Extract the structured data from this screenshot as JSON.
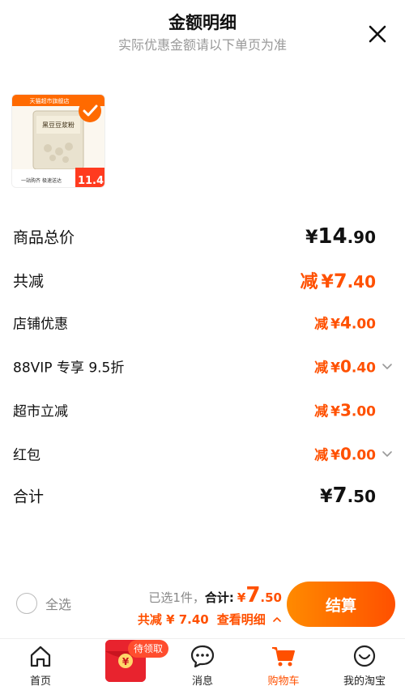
{
  "header": {
    "title": "金额明细",
    "subtitle": "实际优惠金额请以下单页为准"
  },
  "product": {
    "image_label": "黑豆豆浆粉",
    "banner_text": "天猫超市旗舰店",
    "tagline": "一站购齐 极速送达",
    "price_tag": "11.4",
    "selected": true
  },
  "rows": [
    {
      "label": "商品总价",
      "prefix": "",
      "currency": "¥",
      "integer": "14",
      "decimal": ".90",
      "style": "black",
      "has_chevron": false
    },
    {
      "label": "共减",
      "prefix": "减",
      "currency": "¥",
      "integer": "7",
      "decimal": ".40",
      "style": "orange-big",
      "has_chevron": false
    },
    {
      "label": "店铺优惠",
      "prefix": "减",
      "currency": "¥",
      "integer": "4",
      "decimal": ".00",
      "style": "orange",
      "has_chevron": false
    },
    {
      "label": "88VIP 专享 9.5折",
      "prefix": "减",
      "currency": "¥",
      "integer": "0",
      "decimal": ".40",
      "style": "orange",
      "has_chevron": true
    },
    {
      "label": "超市立减",
      "prefix": "减",
      "currency": "¥",
      "integer": "3",
      "decimal": ".00",
      "style": "orange",
      "has_chevron": false
    },
    {
      "label": "红包",
      "prefix": "减",
      "currency": "¥",
      "integer": "0",
      "decimal": ".00",
      "style": "orange",
      "has_chevron": true
    },
    {
      "label": "合计",
      "prefix": "",
      "currency": "¥",
      "integer": "7",
      "decimal": ".50",
      "style": "black",
      "has_chevron": false
    }
  ],
  "bottom_bar": {
    "select_all_label": "全选",
    "selected_count_text": "已选1件，",
    "total_label": "合计:",
    "total_currency": "¥",
    "total_integer": "7",
    "total_decimal": ".50",
    "discount_text": "共减 ¥ 7.40",
    "detail_link": "查看明细",
    "checkout_label": "结算"
  },
  "tabbar": {
    "tabs": [
      {
        "label": "首页",
        "icon": "home-icon",
        "active": false
      },
      {
        "label": "消息",
        "icon": "message-icon",
        "active": false
      },
      {
        "label": "购物车",
        "icon": "cart-icon",
        "active": true
      },
      {
        "label": "我的淘宝",
        "icon": "profile-icon",
        "active": false
      }
    ],
    "redpacket_badge": "待领取"
  },
  "colors": {
    "accent": "#ff5000",
    "checkout_gradient_start": "#ff8a00",
    "checkout_gradient_end": "#ff5000",
    "redpacket": "#e8232e"
  }
}
